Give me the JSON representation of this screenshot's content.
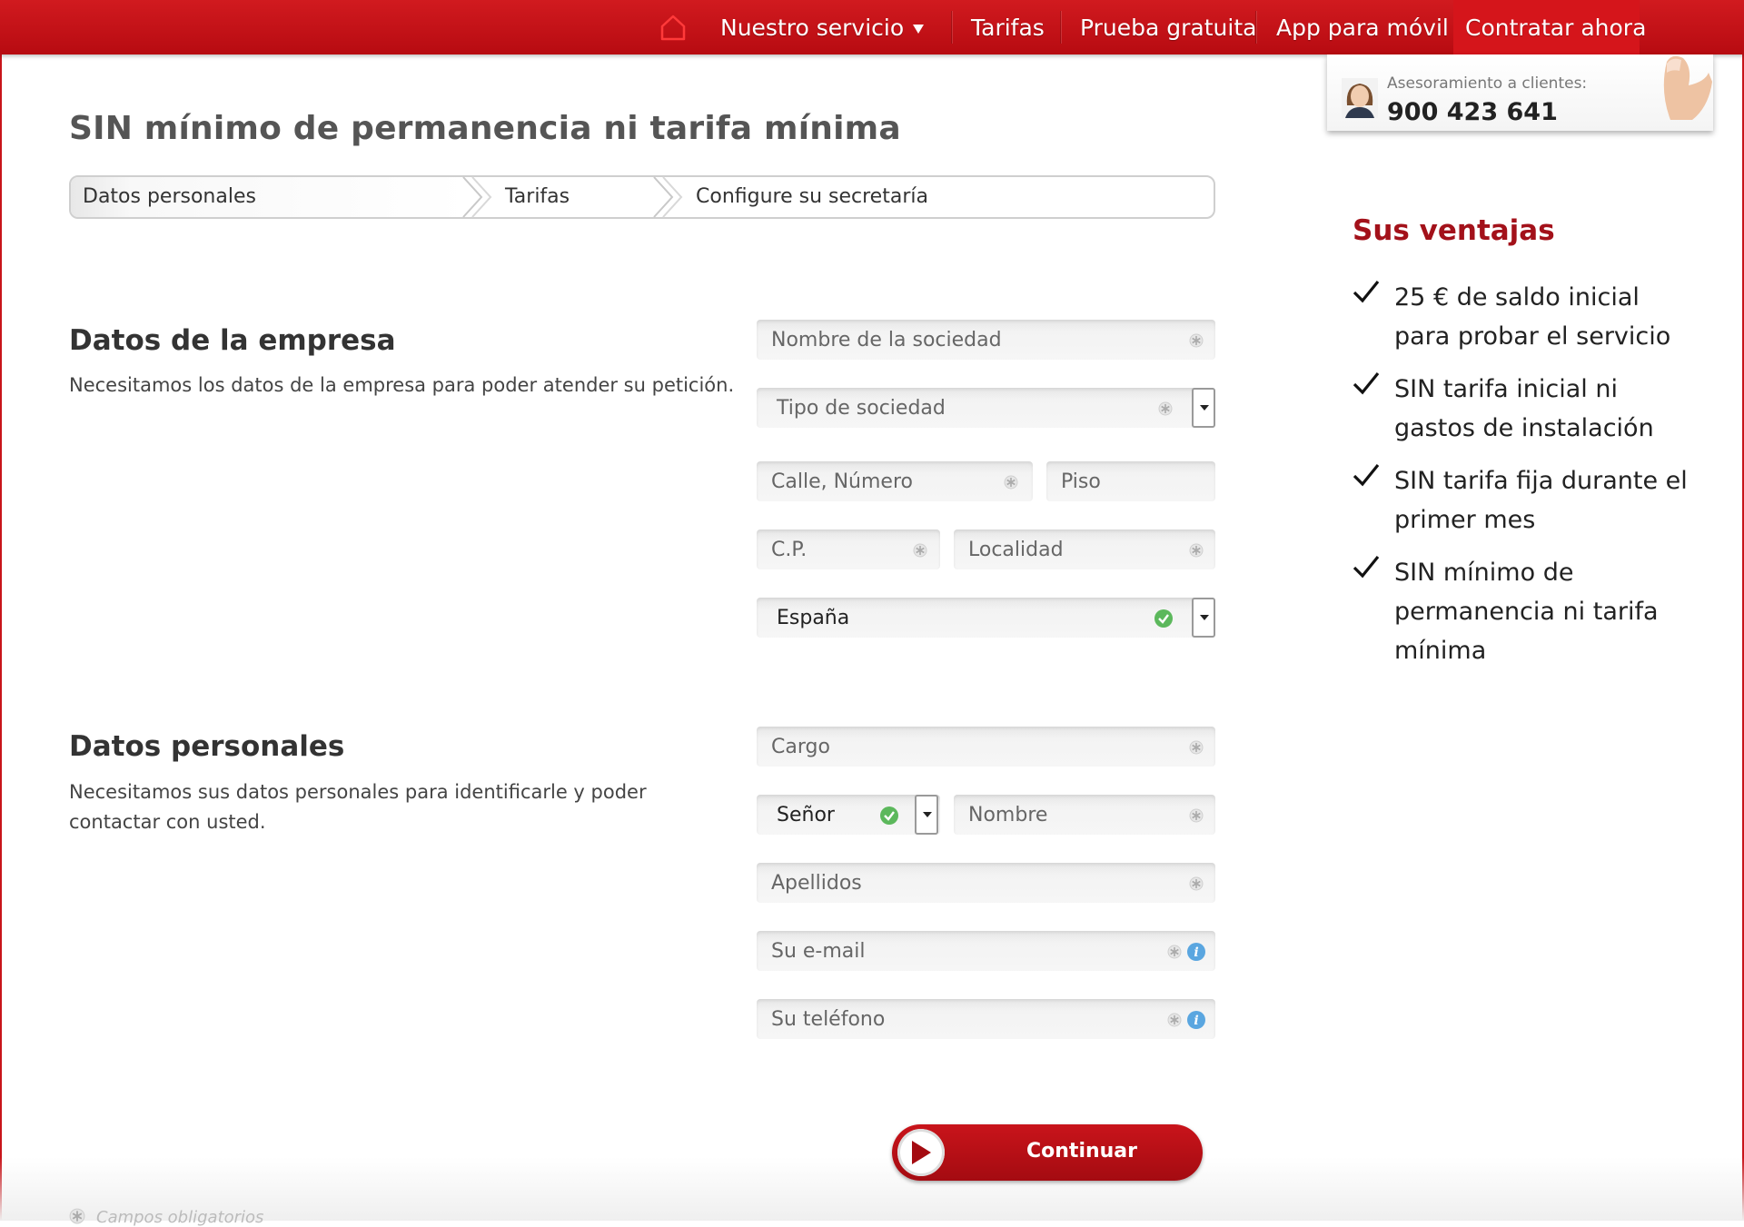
{
  "nav": {
    "items": [
      {
        "label": "Nuestro servicio"
      },
      {
        "label": "Tarifas"
      },
      {
        "label": "Prueba gratuita"
      },
      {
        "label": "App para móvil"
      }
    ],
    "cta_label": "Contratar ahora",
    "home_icon": "home-icon",
    "dropdown_icon": "chevron-down-icon"
  },
  "help": {
    "label": "Asesoramiento a clientes:",
    "phone": "900 423 641"
  },
  "page": {
    "title": "SIN mínimo de permanencia ni tarifa mínima"
  },
  "steps": [
    {
      "label": "Datos personales",
      "active": true
    },
    {
      "label": "Tarifas",
      "active": false
    },
    {
      "label": "Configure su secretaría",
      "active": false
    }
  ],
  "company": {
    "title": "Datos de la empresa",
    "description": "Necesitamos los datos de la empresa para poder atender su petición.",
    "fields": {
      "company_name": {
        "placeholder": "Nombre de la sociedad",
        "required": true
      },
      "company_type": {
        "placeholder": "Tipo de sociedad",
        "required": true
      },
      "street": {
        "placeholder": "Calle, Número",
        "required": true
      },
      "floor": {
        "placeholder": "Piso",
        "required": false
      },
      "postal_code": {
        "placeholder": "C.P.",
        "required": true
      },
      "city": {
        "placeholder": "Localidad",
        "required": true
      },
      "country": {
        "value": "España",
        "valid": true
      }
    }
  },
  "personal": {
    "title": "Datos personales",
    "description": "Necesitamos sus datos personales para identificarle y poder contactar con usted.",
    "fields": {
      "position": {
        "placeholder": "Cargo",
        "required": true
      },
      "salutation": {
        "value": "Señor",
        "valid": true
      },
      "first_name": {
        "placeholder": "Nombre",
        "required": true
      },
      "last_name": {
        "placeholder": "Apellidos",
        "required": true
      },
      "email": {
        "placeholder": "Su e-mail",
        "required": true
      },
      "phone": {
        "placeholder": "Su teléfono",
        "required": true
      }
    }
  },
  "advantages": {
    "title": "Sus ventajas",
    "items": [
      "25 € de saldo inicial para probar el servicio",
      "SIN tarifa inicial ni gastos de instalación",
      "SIN tarifa fija durante el primer mes",
      "SIN mínimo de permanencia ni tarifa mínima"
    ]
  },
  "actions": {
    "continue_label": "Continuar"
  },
  "footnote": "Campos obligatorios",
  "colors": {
    "brand_red": "#c8141a",
    "accent_dark_red": "#a3111a",
    "valid_green": "#5cb85c",
    "info_blue": "#5aa6e0"
  }
}
